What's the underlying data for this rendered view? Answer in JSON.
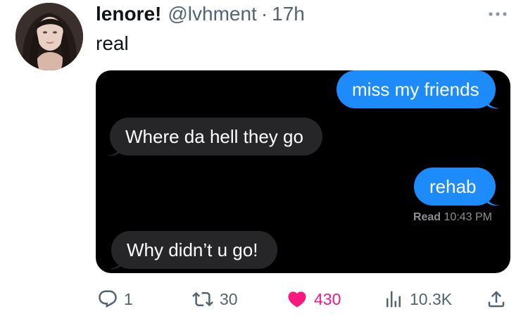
{
  "tweet": {
    "display_name": "lenore!",
    "handle": "@lvhment",
    "separator": "·",
    "time": "17h",
    "text": "real"
  },
  "conversation": {
    "messages": [
      {
        "direction": "sent",
        "text": "miss my friends"
      },
      {
        "direction": "received",
        "text": "Where da hell they go"
      },
      {
        "direction": "sent",
        "text": "rehab"
      },
      {
        "direction": "received",
        "text": "Why didn’t u go!"
      }
    ],
    "read_label": "Read",
    "read_time": "10:43 PM",
    "colors": {
      "sent_bubble": "#1d8bfa",
      "received_bubble": "#262628",
      "background": "#000000"
    }
  },
  "actions": {
    "reply_count": "1",
    "retweet_count": "30",
    "like_count": "430",
    "views_count": "10.3K",
    "liked": true,
    "icons": [
      "reply-icon",
      "retweet-icon",
      "heart-icon",
      "views-icon",
      "share-icon"
    ],
    "like_color": "#f91880"
  }
}
